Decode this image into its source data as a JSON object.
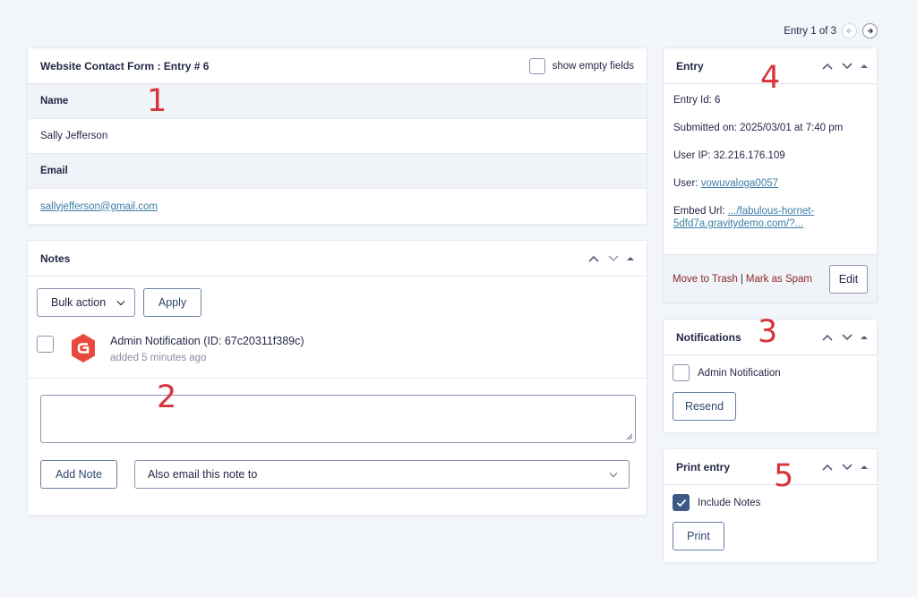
{
  "pager": {
    "text": "Entry 1 of 3"
  },
  "entry_detail": {
    "title": "Website Contact Form : Entry # 6",
    "show_empty_label": "show empty fields",
    "fields": [
      {
        "label": "Name",
        "value": "Sally Jefferson"
      },
      {
        "label": "Email",
        "value": "sallyjefferson@gmail.com"
      }
    ]
  },
  "notes": {
    "title": "Notes",
    "bulk_action_label": "Bulk action",
    "apply_label": "Apply",
    "items": [
      {
        "title": "Admin Notification (ID: 67c20311f389c)",
        "meta": "added 5 minutes ago"
      }
    ],
    "add_note_label": "Add Note",
    "email_select_label": "Also email this note to"
  },
  "entry_meta": {
    "title": "Entry",
    "entry_id": "Entry Id: 6",
    "submitted": "Submitted on: 2025/03/01 at 7:40 pm",
    "user_ip": "User IP: 32.216.176.109",
    "user_label": "User:",
    "user_link": "vowuvaloga0057",
    "embed_label": "Embed Url:",
    "embed_link_1": ".../fabulous-hornet-",
    "embed_link_2": "5dfd7a.gravitydemo.com/?...",
    "trash_label": "Move to Trash",
    "separator": "|",
    "spam_label": "Mark as Spam",
    "edit_label": "Edit"
  },
  "notifications": {
    "title": "Notifications",
    "item_label": "Admin Notification",
    "resend_label": "Resend"
  },
  "print_entry": {
    "title": "Print entry",
    "include_notes_label": "Include Notes",
    "include_notes_checked": true,
    "print_label": "Print"
  },
  "annotations": [
    "1",
    "2",
    "3",
    "4",
    "5"
  ],
  "colors": {
    "background": "#f2f5f9",
    "text": "#242748",
    "link": "#3e7da6",
    "danger_link": "#8b2a2a",
    "annotation": "#d5343c",
    "checkbox_checked": "#3e5a85"
  }
}
